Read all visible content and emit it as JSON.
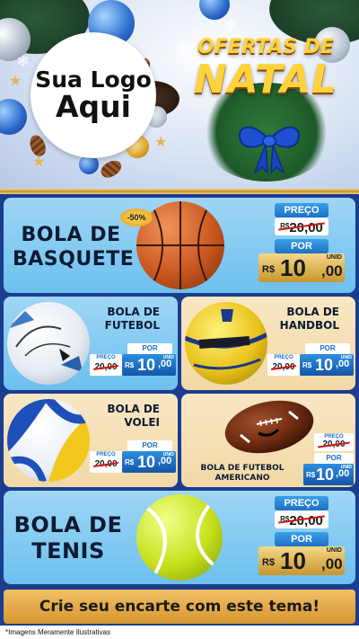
{
  "header": {
    "logo_line1": "Sua Logo",
    "logo_line2": "Aqui",
    "promo_line1": "OFERTAS DE",
    "promo_line2": "NATAL"
  },
  "featured_top": {
    "name_line1": "BOLA DE",
    "name_line2": "BASQUETE",
    "discount_badge": "-50%",
    "price_label": "PREÇO",
    "old_currency": "R$",
    "old_price": "20,00",
    "por_label": "POR",
    "new_currency": "R$",
    "new_value": "10",
    "new_cents": ",00",
    "unit": "UNID"
  },
  "grid": [
    {
      "name_line1": "BOLA DE",
      "name_line2": "FUTEBOL",
      "por_label": "POR",
      "old_label": "PREÇO",
      "old_price": "20,00",
      "new_currency": "R$",
      "new_value": "10",
      "new_cents": ",00",
      "unit": "UNID"
    },
    {
      "name_line1": "BOLA DE",
      "name_line2": "HANDBOL",
      "por_label": "POR",
      "old_label": "PREÇO",
      "old_price": "20,00",
      "new_currency": "R$",
      "new_value": "10",
      "new_cents": ",00",
      "unit": "UNID"
    },
    {
      "name_line1": "BOLA DE",
      "name_line2": "VOLEI",
      "por_label": "POR",
      "old_label": "PREÇO",
      "old_price": "20,00",
      "new_currency": "R$",
      "new_value": "10",
      "new_cents": ",00",
      "unit": "UNID"
    },
    {
      "name_line1": "BOLA DE FUTEBOL",
      "name_line2": "AMERICANO",
      "por_label": "POR",
      "old_label": "PREÇO",
      "old_price": "20,00",
      "new_currency": "R$",
      "new_value": "10",
      "new_cents": ",00",
      "unit": "UNID"
    }
  ],
  "featured_bottom": {
    "name_line1": "BOLA DE",
    "name_line2": "TENIS",
    "price_label": "PREÇO",
    "old_currency": "R$",
    "old_price": "20,00",
    "por_label": "POR",
    "new_currency": "R$",
    "new_value": "10",
    "new_cents": ",00",
    "unit": "UNID"
  },
  "footer": {
    "cta": "Crie seu encarte com este tema!",
    "disclaimer": "*Imagens Meramente Ilustrativas"
  },
  "colors": {
    "panel_blue": "#8fd0f4",
    "panel_cream": "#f6e2b8",
    "background": "#1b3d8f",
    "gold": "#d8962e",
    "price_blue": "#1d6fc4"
  }
}
